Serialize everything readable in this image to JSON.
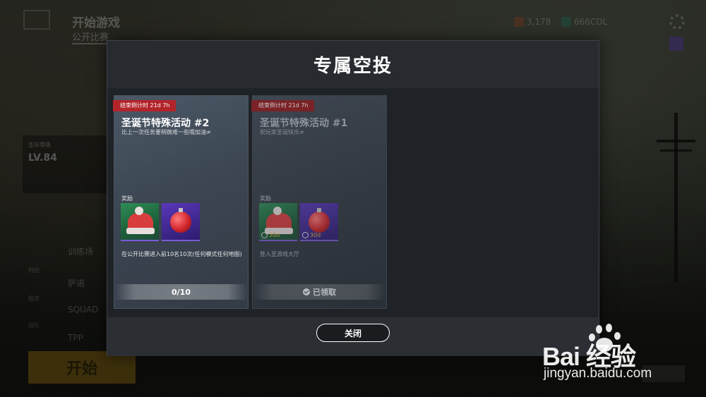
{
  "background": {
    "title": "开始游戏",
    "subtitle": "公开比赛",
    "currency1": "3,178",
    "currency2": "666CDL",
    "level_label": "生存等级",
    "level": "LV.84",
    "modes": [
      "训练场",
      "萨诺",
      "SQUAD",
      "TPP"
    ],
    "side_labels": [
      "地图",
      "服务",
      "组队"
    ],
    "start_label": "开始"
  },
  "modal": {
    "title": "专属空投",
    "close_label": "关闭",
    "reward_label": "奖励",
    "countdown_label": "结束倒计时",
    "events": [
      {
        "countdown": "21d 7h",
        "title": "圣诞节特殊活动 #2",
        "desc": "比上一次任务要稍微难一些哦加油≠",
        "rewards": [
          {
            "icon": "santa-hat-icon"
          },
          {
            "icon": "christmas-ornament-icon"
          }
        ],
        "task": "在公开比赛进入前10名10次(任何模式任何地图)",
        "progress": "0/10",
        "completed": false
      },
      {
        "countdown": "21d 7h",
        "title": "圣诞节特殊活动 #1",
        "desc": "祝玩家圣诞快乐≠",
        "rewards": [
          {
            "icon": "santa-hat-icon",
            "duration": "30d"
          },
          {
            "icon": "christmas-ornament-icon",
            "duration": "30d"
          }
        ],
        "task": "登入至游戏大厅",
        "status": "已领取",
        "completed": true
      }
    ]
  },
  "watermark": {
    "brand": "Bai  经验",
    "url": "jingyan.baidu.com"
  },
  "colors": {
    "countdown_tag": "#b3242a",
    "modal_bg": "#2b2e33",
    "card_bg": "#3c4653",
    "reward_underline": "#7a5bd6",
    "duration_text": "#e2b23a"
  }
}
